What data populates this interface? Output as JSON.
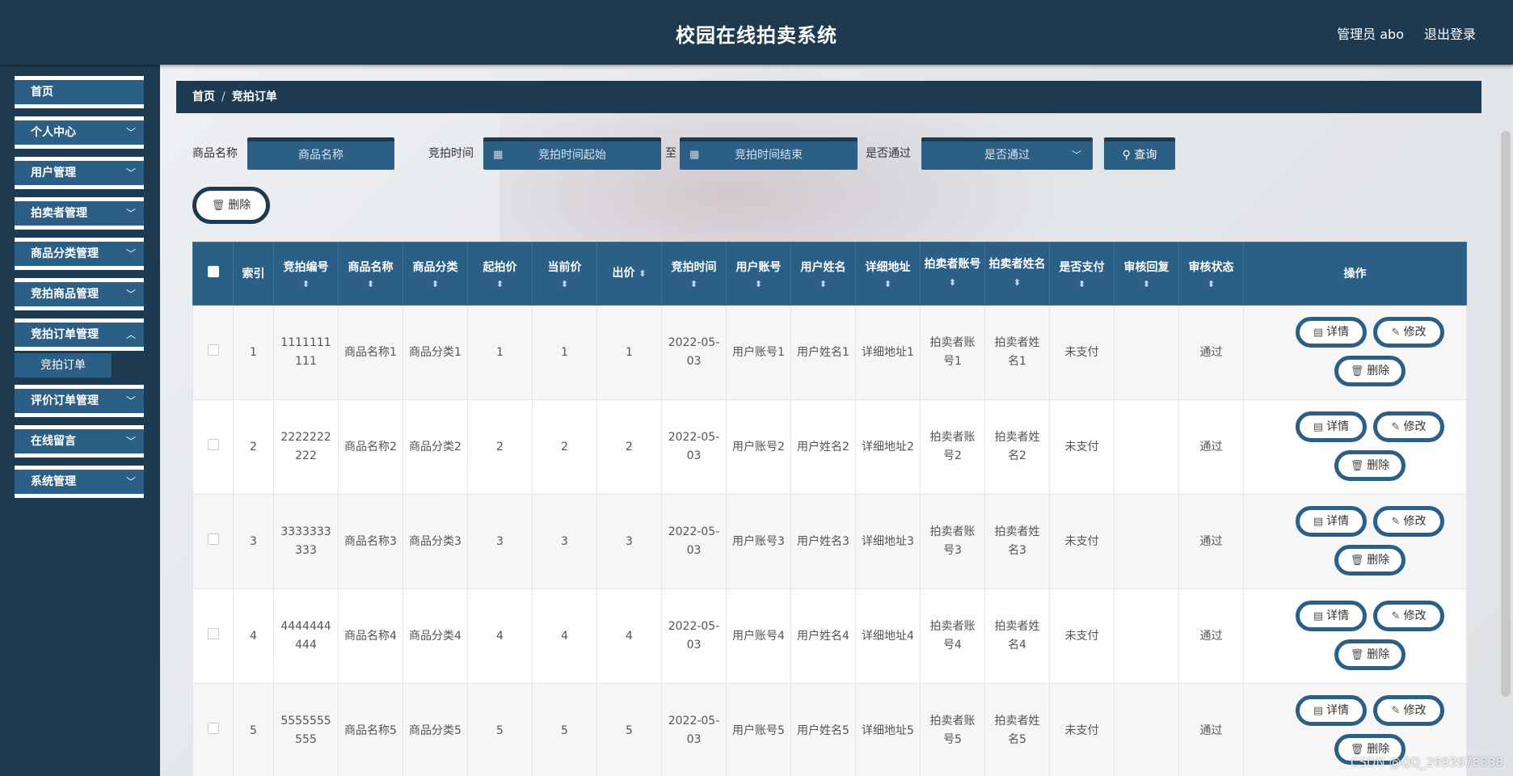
{
  "header": {
    "title": "校园在线拍卖系统",
    "user": "管理员 abo",
    "logout": "退出登录"
  },
  "sidebar": {
    "items": [
      {
        "label": "首页",
        "chevron": ""
      },
      {
        "label": "个人中心",
        "chevron": "﹀"
      },
      {
        "label": "用户管理",
        "chevron": "﹀"
      },
      {
        "label": "拍卖者管理",
        "chevron": "﹀"
      },
      {
        "label": "商品分类管理",
        "chevron": "﹀"
      },
      {
        "label": "竞拍商品管理",
        "chevron": "﹀"
      },
      {
        "label": "竞拍订单管理",
        "chevron": "︿"
      },
      {
        "label": "评价订单管理",
        "chevron": "﹀"
      },
      {
        "label": "在线留言",
        "chevron": "﹀"
      },
      {
        "label": "系统管理",
        "chevron": "﹀"
      }
    ],
    "sub_items": [
      {
        "label": "竞拍订单"
      }
    ]
  },
  "breadcrumb": {
    "home": "首页",
    "sep": "/",
    "current": "竞拍订单"
  },
  "search": {
    "name_label": "商品名称",
    "name_placeholder": "商品名称",
    "time_label": "竞拍时间",
    "time_start_placeholder": "竞拍时间起始",
    "to": "至",
    "time_end_placeholder": "竞拍时间结束",
    "pass_label": "是否通过",
    "pass_placeholder": "是否通过",
    "query_label": "查询"
  },
  "toolbar": {
    "delete_label": "删除"
  },
  "table": {
    "columns": [
      "索引",
      "竞拍编号",
      "商品名称",
      "商品分类",
      "起拍价",
      "当前价",
      "出价",
      "竞拍时间",
      "用户账号",
      "用户姓名",
      "详细地址",
      "拍卖者账号",
      "拍卖者姓名",
      "是否支付",
      "审核回复",
      "审核状态",
      "操作"
    ],
    "rows": [
      [
        "1",
        "1111111111",
        "商品名称1",
        "商品分类1",
        "1",
        "1",
        "1",
        "2022-05-03",
        "用户账号1",
        "用户姓名1",
        "详细地址1",
        "拍卖者账号1",
        "拍卖者姓名1",
        "未支付",
        "",
        "通过"
      ],
      [
        "2",
        "2222222222",
        "商品名称2",
        "商品分类2",
        "2",
        "2",
        "2",
        "2022-05-03",
        "用户账号2",
        "用户姓名2",
        "详细地址2",
        "拍卖者账号2",
        "拍卖者姓名2",
        "未支付",
        "",
        "通过"
      ],
      [
        "3",
        "3333333333",
        "商品名称3",
        "商品分类3",
        "3",
        "3",
        "3",
        "2022-05-03",
        "用户账号3",
        "用户姓名3",
        "详细地址3",
        "拍卖者账号3",
        "拍卖者姓名3",
        "未支付",
        "",
        "通过"
      ],
      [
        "4",
        "4444444444",
        "商品名称4",
        "商品分类4",
        "4",
        "4",
        "4",
        "2022-05-03",
        "用户账号4",
        "用户姓名4",
        "详细地址4",
        "拍卖者账号4",
        "拍卖者姓名4",
        "未支付",
        "",
        "通过"
      ],
      [
        "5",
        "5555555555",
        "商品名称5",
        "商品分类5",
        "5",
        "5",
        "5",
        "2022-05-03",
        "用户账号5",
        "用户姓名5",
        "详细地址5",
        "拍卖者账号5",
        "拍卖者姓名5",
        "未支付",
        "",
        "通过"
      ]
    ],
    "actions": {
      "detail": "详情",
      "edit": "修改",
      "delete": "删除"
    },
    "sort_icon": "⬍"
  },
  "watermark": "CSDN @QQ_2693978338",
  "icons": {
    "calendar": "calendar-icon",
    "search": "search-icon",
    "trash": "trash-icon",
    "document": "document-icon",
    "edit": "edit-icon"
  },
  "colors": {
    "navy": "#1e3a50",
    "blue": "#2c5f86"
  }
}
